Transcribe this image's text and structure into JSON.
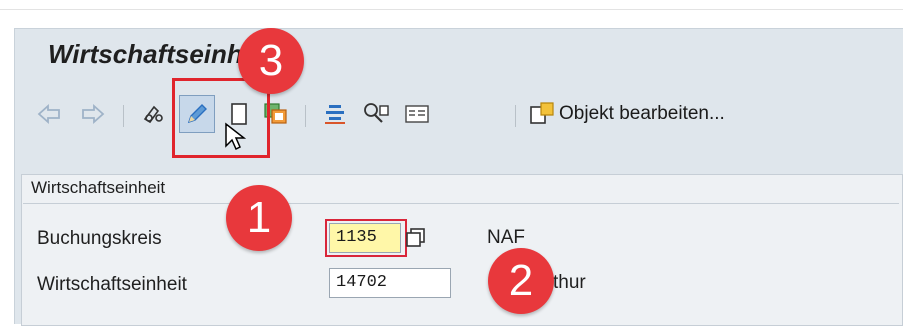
{
  "window": {
    "title": "Wirtschaftseinheit"
  },
  "toolbar": {
    "items": [
      {
        "name": "back-arrow-icon"
      },
      {
        "name": "forward-arrow-icon"
      },
      {
        "name": "display-glasses-icon"
      },
      {
        "name": "change-pencil-icon"
      },
      {
        "name": "create-document-icon"
      },
      {
        "name": "copy-object-icon"
      },
      {
        "name": "align-list-icon"
      },
      {
        "name": "technical-settings-icon"
      },
      {
        "name": "details-list-icon"
      },
      {
        "name": "edit-object-icon"
      }
    ],
    "edit_object_label": "Objekt bearbeiten..."
  },
  "form": {
    "group_title": "Wirtschaftseinheit",
    "fields": [
      {
        "label": "Buchungskreis",
        "value": "1135",
        "description": "NAF"
      },
      {
        "label": "Wirtschaftseinheit",
        "value": "14702",
        "description": "thur"
      }
    ]
  },
  "annotations": {
    "badges": [
      "1",
      "2",
      "3"
    ]
  },
  "colors": {
    "frame_bg": "#dfe6ec",
    "badge": "#e8383c",
    "active_field": "#fff7a8",
    "accent_blue": "#2a6fc0"
  }
}
